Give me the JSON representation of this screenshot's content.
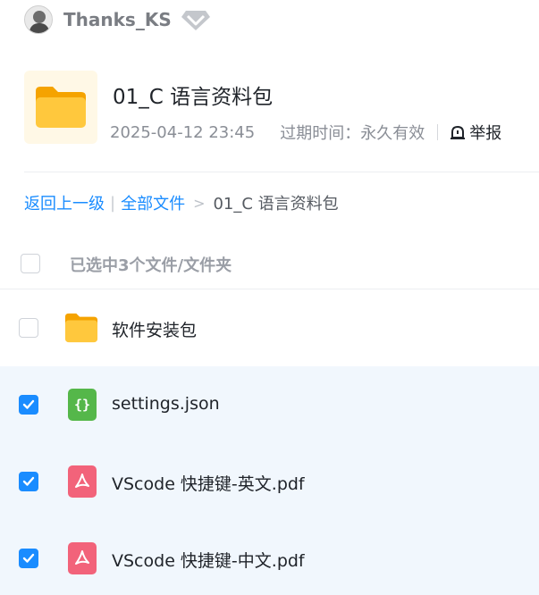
{
  "user": {
    "name": "Thanks_KS"
  },
  "share": {
    "title": "01_C 语言资料包",
    "date": "2025-04-12 23:45",
    "expire": "过期时间：永久有效",
    "report_label": "举报"
  },
  "breadcrumb": {
    "back": "返回上一级",
    "all": "全部文件",
    "arrow": ">",
    "current": "01_C 语言资料包"
  },
  "selection": {
    "label": "已选中3个文件/文件夹"
  },
  "files": [
    {
      "name": "软件安装包",
      "type": "folder",
      "checked": false
    },
    {
      "name": "settings.json",
      "type": "json",
      "checked": true
    },
    {
      "name": "VScode 快捷键-英文.pdf",
      "type": "pdf",
      "checked": true
    },
    {
      "name": "VScode 快捷键-中文.pdf",
      "type": "pdf",
      "checked": true
    }
  ],
  "colors": {
    "accent": "#1a8cff",
    "folder": "#ffc83d",
    "json": "#55b74a",
    "pdf": "#f2637a",
    "selected_row": "#f1f7fd"
  },
  "icons": {
    "avatar": "user-avatar",
    "vip": "diamond-vip-icon",
    "folder": "folder-icon",
    "json": "json-file-icon",
    "pdf": "pdf-file-icon",
    "report": "alert-bell-icon",
    "checkbox": "checkbox-icon"
  }
}
